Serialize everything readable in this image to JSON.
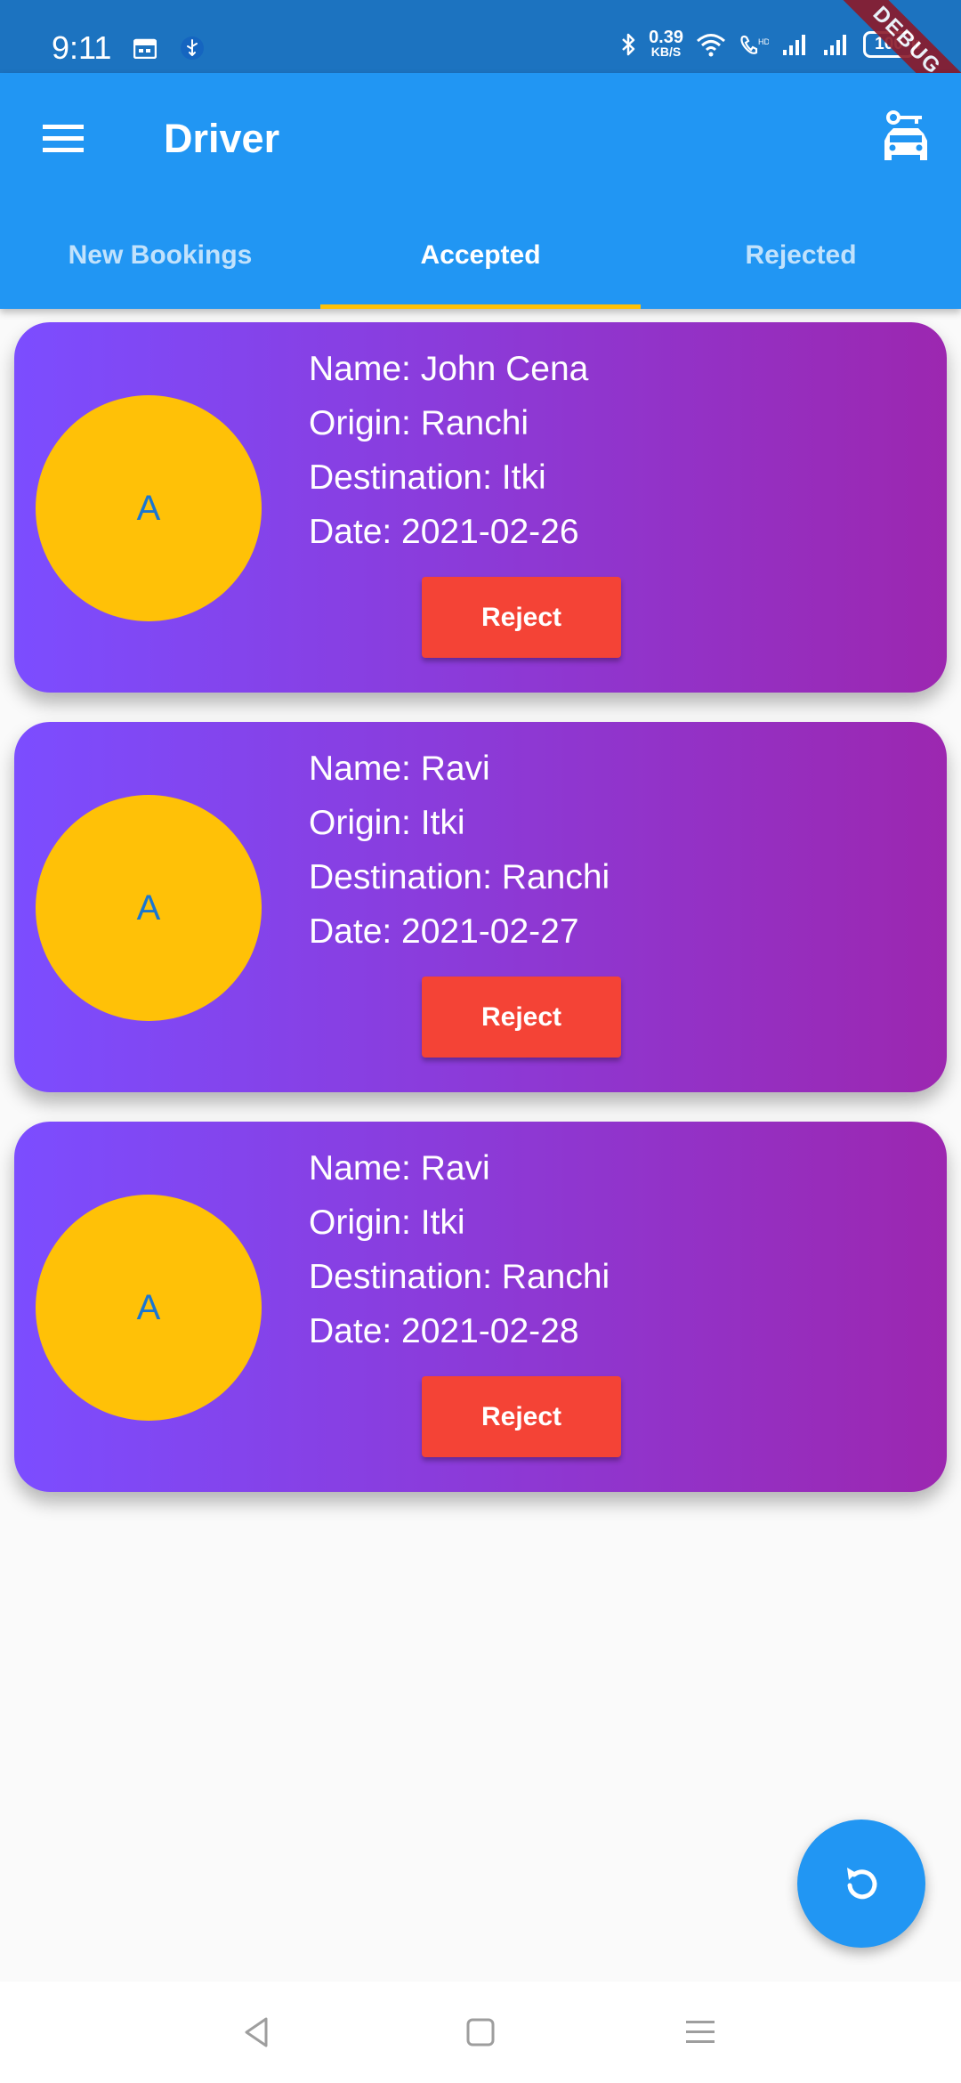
{
  "status_bar": {
    "time": "9:11",
    "net_speed_value": "0.39",
    "net_speed_unit": "KB/S",
    "battery": "100",
    "debug_banner": "DEBUG",
    "icons": [
      "calendar-icon",
      "usb-icon",
      "bluetooth-icon",
      "wifi-icon",
      "volte-icon",
      "signal-icon",
      "signal-icon",
      "battery-icon"
    ]
  },
  "app_bar": {
    "title": "Driver",
    "menu_icon": "hamburger-menu-icon",
    "action_icon": "car-icon"
  },
  "tabs": [
    {
      "label": "New Bookings",
      "active": false
    },
    {
      "label": "Accepted",
      "active": true
    },
    {
      "label": "Rejected",
      "active": false
    }
  ],
  "bookings": [
    {
      "avatar": "A",
      "name": "Name: John Cena",
      "origin": "Origin: Ranchi",
      "destination": "Destination: Itki",
      "date": "Date: 2021-02-26",
      "action": "Reject"
    },
    {
      "avatar": "A",
      "name": "Name: Ravi",
      "origin": "Origin: Itki",
      "destination": "Destination: Ranchi",
      "date": "Date: 2021-02-27",
      "action": "Reject"
    },
    {
      "avatar": "A",
      "name": "Name: Ravi",
      "origin": "Origin: Itki",
      "destination": "Destination: Ranchi",
      "date": "Date: 2021-02-28",
      "action": "Reject"
    }
  ],
  "fab_icon": "refresh-icon",
  "colors": {
    "status_bar": "#1c73c0",
    "app_bar": "#2196f3",
    "tab_indicator": "#ffc107",
    "card_gradient_start": "#7c4dff",
    "card_gradient_end": "#9c27b0",
    "avatar": "#ffc107",
    "avatar_text": "#1976d2",
    "reject_button": "#f44336"
  },
  "nav_bar": {
    "icons": [
      "back-icon",
      "home-icon",
      "recents-icon"
    ]
  }
}
